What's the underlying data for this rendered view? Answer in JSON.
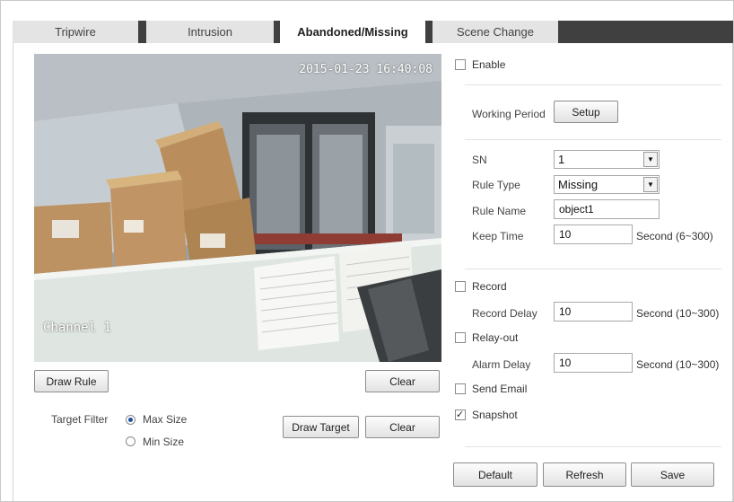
{
  "tabs": [
    {
      "label": "Tripwire"
    },
    {
      "label": "Intrusion"
    },
    {
      "label": "Abandoned/Missing"
    },
    {
      "label": "Scene Change"
    }
  ],
  "video": {
    "timestamp": "2015-01-23 16:40:08",
    "channel": "Channel 1"
  },
  "video_buttons": {
    "draw_rule": "Draw Rule",
    "clear": "Clear"
  },
  "target_filter": {
    "label": "Target Filter",
    "max_size": "Max Size",
    "min_size": "Min Size",
    "selected": "Max Size",
    "draw_target": "Draw Target",
    "clear": "Clear"
  },
  "settings": {
    "enable_label": "Enable",
    "enable_checked": false,
    "working_period_label": "Working Period",
    "setup_button": "Setup",
    "sn_label": "SN",
    "sn_value": "1",
    "rule_type_label": "Rule Type",
    "rule_type_value": "Missing",
    "rule_name_label": "Rule Name",
    "rule_name_value": "object1",
    "keep_time_label": "Keep Time",
    "keep_time_value": "10",
    "keep_time_unit": "Second (6~300)",
    "record_label": "Record",
    "record_checked": false,
    "record_delay_label": "Record Delay",
    "record_delay_value": "10",
    "record_delay_unit": "Second (10~300)",
    "relay_out_label": "Relay-out",
    "relay_out_checked": false,
    "alarm_delay_label": "Alarm Delay",
    "alarm_delay_value": "10",
    "alarm_delay_unit": "Second (10~300)",
    "send_email_label": "Send Email",
    "send_email_checked": false,
    "snapshot_label": "Snapshot",
    "snapshot_checked": true
  },
  "footer": {
    "default": "Default",
    "refresh": "Refresh",
    "save": "Save"
  }
}
